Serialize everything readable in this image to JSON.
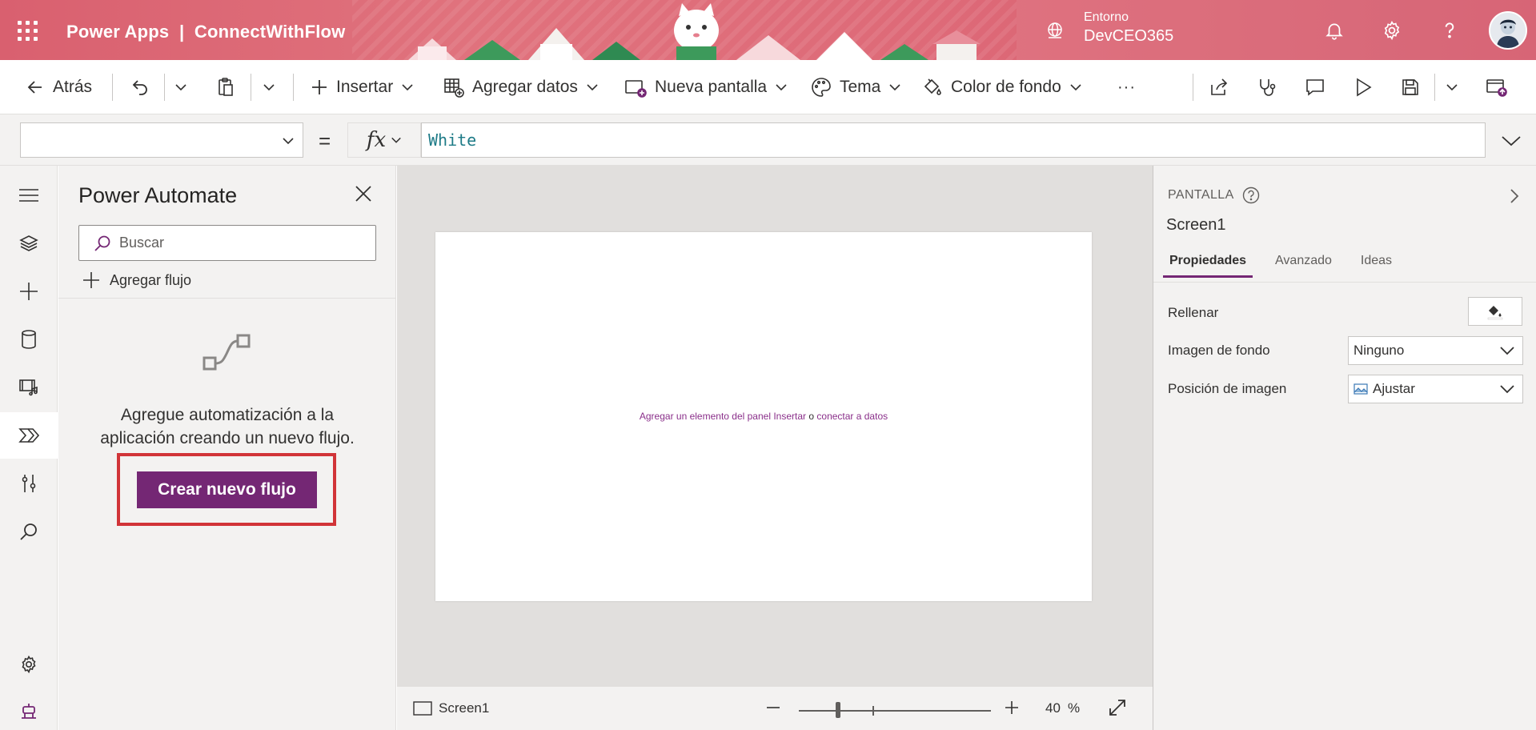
{
  "header": {
    "app_name": "Power Apps  |  ConnectWithFlow",
    "environment_label": "Entorno",
    "environment_value": "DevCEO365"
  },
  "command_bar": {
    "back": "Atrás",
    "insert": "Insertar",
    "add_data": "Agregar datos",
    "new_screen": "Nueva pantalla",
    "theme": "Tema",
    "background_color": "Color de fondo",
    "more": "···"
  },
  "formula_bar": {
    "property_value": "",
    "equals": "=",
    "fx": "fx",
    "formula": "White"
  },
  "power_automate_panel": {
    "title": "Power Automate",
    "search_placeholder": "Buscar",
    "add_flow": "Agregar flujo",
    "empty_message_line1": "Agregue automatización a la",
    "empty_message_line2": "aplicación creando un nuevo flujo.",
    "create_button": "Crear nuevo flujo"
  },
  "canvas": {
    "hint_part1": "Agregar un elemento del panel Insertar",
    "hint_sep": "o",
    "hint_part2": "conectar a datos"
  },
  "status_bar": {
    "screen_name": "Screen1",
    "zoom_value": "40",
    "zoom_unit": "%",
    "zoom_percent": 40
  },
  "properties_panel": {
    "kind": "PANTALLA",
    "name": "Screen1",
    "tabs": [
      "Propiedades",
      "Avanzado",
      "Ideas"
    ],
    "active_tab": "Propiedades",
    "fill_label": "Rellenar",
    "background_image_label": "Imagen de fondo",
    "background_image_value": "Ninguno",
    "image_position_label": "Posición de imagen",
    "image_position_value": "Ajustar"
  },
  "colors": {
    "brand_purple": "#742774",
    "header_pink": "#d9606f",
    "highlight_red": "#d13438",
    "formula_teal": "#1e7b87"
  },
  "icons": {
    "rail": [
      "hamburger-icon",
      "layers-icon",
      "plus-icon",
      "database-icon",
      "media-icon",
      "power-automate-icon",
      "tools-icon",
      "search-icon",
      "settings-icon",
      "virtual-agent-icon"
    ]
  }
}
